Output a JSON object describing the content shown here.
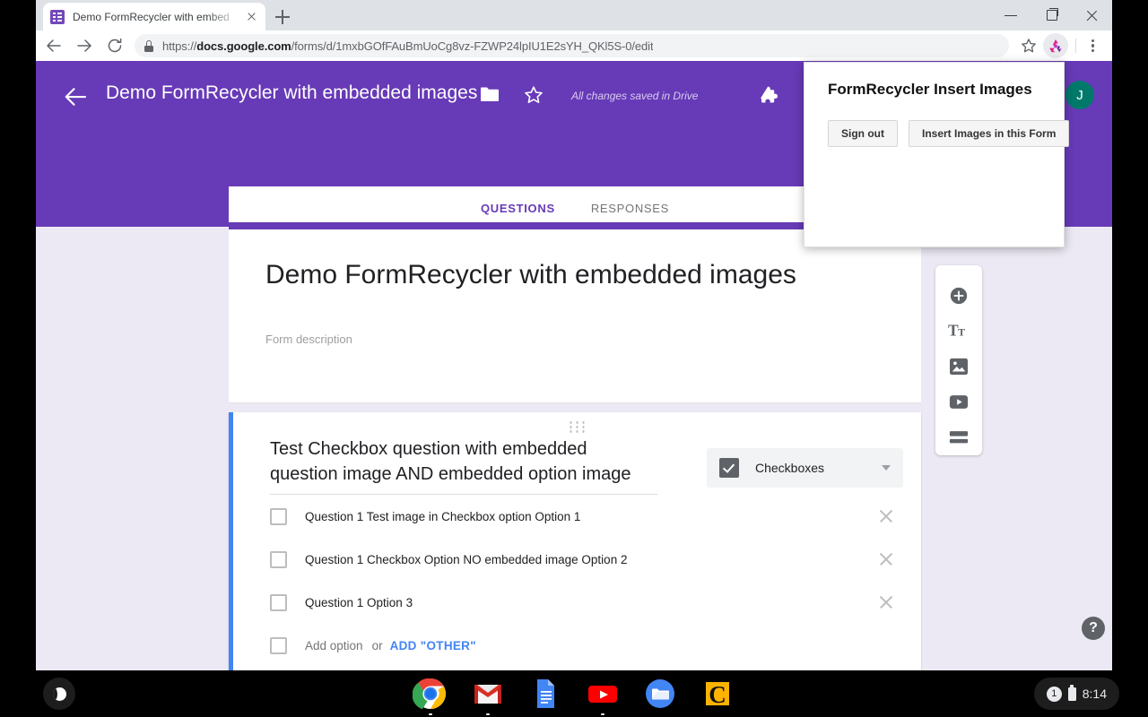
{
  "browser": {
    "tab": {
      "title": "Demo FormRecycler with embed",
      "favicon": "google-forms-icon",
      "close": "close-tab-icon"
    },
    "new_tab": "+",
    "window_controls": {
      "minimize": "minimize-icon",
      "maximize": "maximize-icon",
      "close": "close-window-icon"
    },
    "nav": {
      "back": "back-arrow-icon",
      "forward": "forward-arrow-icon",
      "reload": "reload-icon"
    },
    "omnibox": {
      "lock": "lock-icon",
      "scheme": "https://",
      "domain": "docs.google.com",
      "path": "/forms/d/1mxbGOfFAuBmUoCg8vz-FZWP24lpIU1E2sYH_QKl5S-0/edit",
      "full_url": "https://docs.google.com/forms/d/1mxbGOfFAuBmUoCg8vz-FZWP24lpIU1E2sYH_QKl5S-0/edit"
    },
    "bookmark_star": "star-icon",
    "extension_icon": "recycle-icon",
    "menu": "three-dot-menu-icon"
  },
  "forms_header": {
    "back": "back-arrow-icon",
    "title": "Demo FormRecycler with embedded images",
    "folder": "folder-icon",
    "star": "star-icon",
    "save_status": "All changes saved in Drive",
    "puzzle": "puzzle-icon",
    "avatar_initial": "J",
    "accent_color": "#673ab7"
  },
  "form_tabs": [
    {
      "label": "QUESTIONS",
      "active": true
    },
    {
      "label": "RESPONSES",
      "active": false
    }
  ],
  "form": {
    "title": "Demo FormRecycler with embedded images",
    "description_placeholder": "Form description"
  },
  "question": {
    "drag_handle": "drag-handle-icon",
    "title": "Test Checkbox question with embedded question image AND embedded option image",
    "type": {
      "icon": "checkbox-checked-icon",
      "label": "Checkboxes",
      "caret": "chevron-down-icon"
    },
    "options": [
      {
        "label": "Question 1 Test image in Checkbox option Option 1"
      },
      {
        "label": "Question 1 Checkbox Option NO embedded image Option 2"
      },
      {
        "label": "Question 1 Option 3"
      }
    ],
    "add_option": {
      "label": "Add option",
      "or": "or",
      "add_other": "ADD \"OTHER\""
    },
    "remove_icon": "close-icon",
    "active_border_color": "#4285f4"
  },
  "side_toolbar": [
    {
      "name": "add-question-button",
      "icon": "plus-circle-icon"
    },
    {
      "name": "add-title-button",
      "icon": "title-text-icon"
    },
    {
      "name": "add-image-button",
      "icon": "image-icon"
    },
    {
      "name": "add-video-button",
      "icon": "video-icon"
    },
    {
      "name": "add-section-button",
      "icon": "section-icon"
    }
  ],
  "help": {
    "label": "?"
  },
  "extension_popup": {
    "title": "FormRecycler Insert Images",
    "buttons": [
      {
        "label": "Sign out"
      },
      {
        "label": "Insert Images in this Form"
      }
    ]
  },
  "shelf": {
    "launcher": "launcher-icon",
    "apps": [
      {
        "name": "chrome",
        "running": true
      },
      {
        "name": "gmail",
        "running": true
      },
      {
        "name": "google-docs",
        "running": false
      },
      {
        "name": "youtube",
        "running": true
      },
      {
        "name": "files",
        "running": false
      },
      {
        "name": "caret-app",
        "running": false
      }
    ],
    "tray": {
      "notification_count": "1",
      "battery": "battery-icon",
      "time": "8:14"
    }
  }
}
